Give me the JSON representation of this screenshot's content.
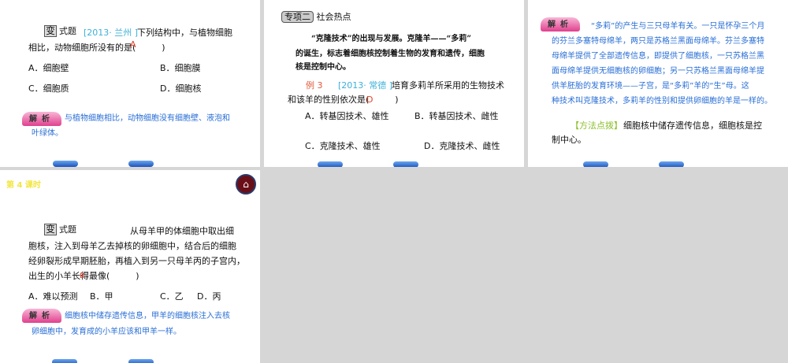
{
  "slide1": {
    "bian": "变",
    "label": "式题",
    "source": "[2013· 兰州 ]",
    "q1": "下列结构中，与植物细胞",
    "q2": "相比，动物细胞所没有的是(　　　)",
    "answer": "A",
    "options": [
      "A．细胞壁",
      "B．细胞膜",
      "C．细胞质",
      "D．细胞核"
    ],
    "jiexi": "解析",
    "a1": "与植物细胞相比，动物细胞没有细胞壁、液泡和",
    "a2": "叶绿体。"
  },
  "slide2": {
    "badge": "专项二",
    "topic": "社会热点",
    "p1": "“克隆技术”的出现与发展。克隆羊——“多莉”",
    "p2": "的诞生，标志着细胞核控制着生物的发育和遗传，细胞",
    "p3": "核是控制中心。",
    "example": "例 3",
    "source": "[2013· 常德 ]",
    "q1": "培育多莉羊所采用的生物技术",
    "q2": "和该羊的性别依次是(　　　)",
    "answer": "D",
    "options": [
      "A．转基因技术、雄性",
      "B．转基因技术、雌性",
      "C．克隆技术、雄性",
      "D．克隆技术、雌性"
    ]
  },
  "slide3": {
    "jiexi": "解析",
    "lines": [
      "“多莉”的产生与三只母羊有关。一只是怀孕三个月",
      "的芬兰多塞特母绵羊，两只是苏格兰黑面母绵羊。芬兰多塞特",
      "母绵羊提供了全部遗传信息，即提供了细胞核，一只苏格兰黑",
      "面母绵羊提供无细胞核的卵细胞；另一只苏格兰黑面母绵羊提",
      "供羊胚胎的发育环境——子宫，是“多莉”羊的“生”母。这",
      "种技术叫克隆技术，多莉羊的性别和提供卵细胞的羊是一样的。"
    ],
    "tip": "【方法点拨】",
    "tip1": "细胞核中储存遗传信息，细胞核是控",
    "tip2": "制中心。"
  },
  "slide4": {
    "lesson": "第 4 课时",
    "home_icon": "home-icon",
    "bian": "变",
    "label": "式题",
    "q1": "从母羊甲的体细胞中取出细",
    "q2": "胞核，注入到母羊乙去掉核的卵细胞中，结合后的细胞",
    "q3": "经卵裂形成早期胚胎，再植入到另一只母羊丙的子宫内，",
    "q4": "出生的小羊长得最像(　　　)",
    "answer": "B",
    "options": [
      "A．难以预测",
      "B．甲",
      "C．乙",
      "D．丙"
    ],
    "jiexi": "解析",
    "a1": "细胞核中储存遗传信息，甲羊的细胞核注入去核",
    "a2": "卵细胞中，发育成的小羊应该和甲羊一样。"
  }
}
